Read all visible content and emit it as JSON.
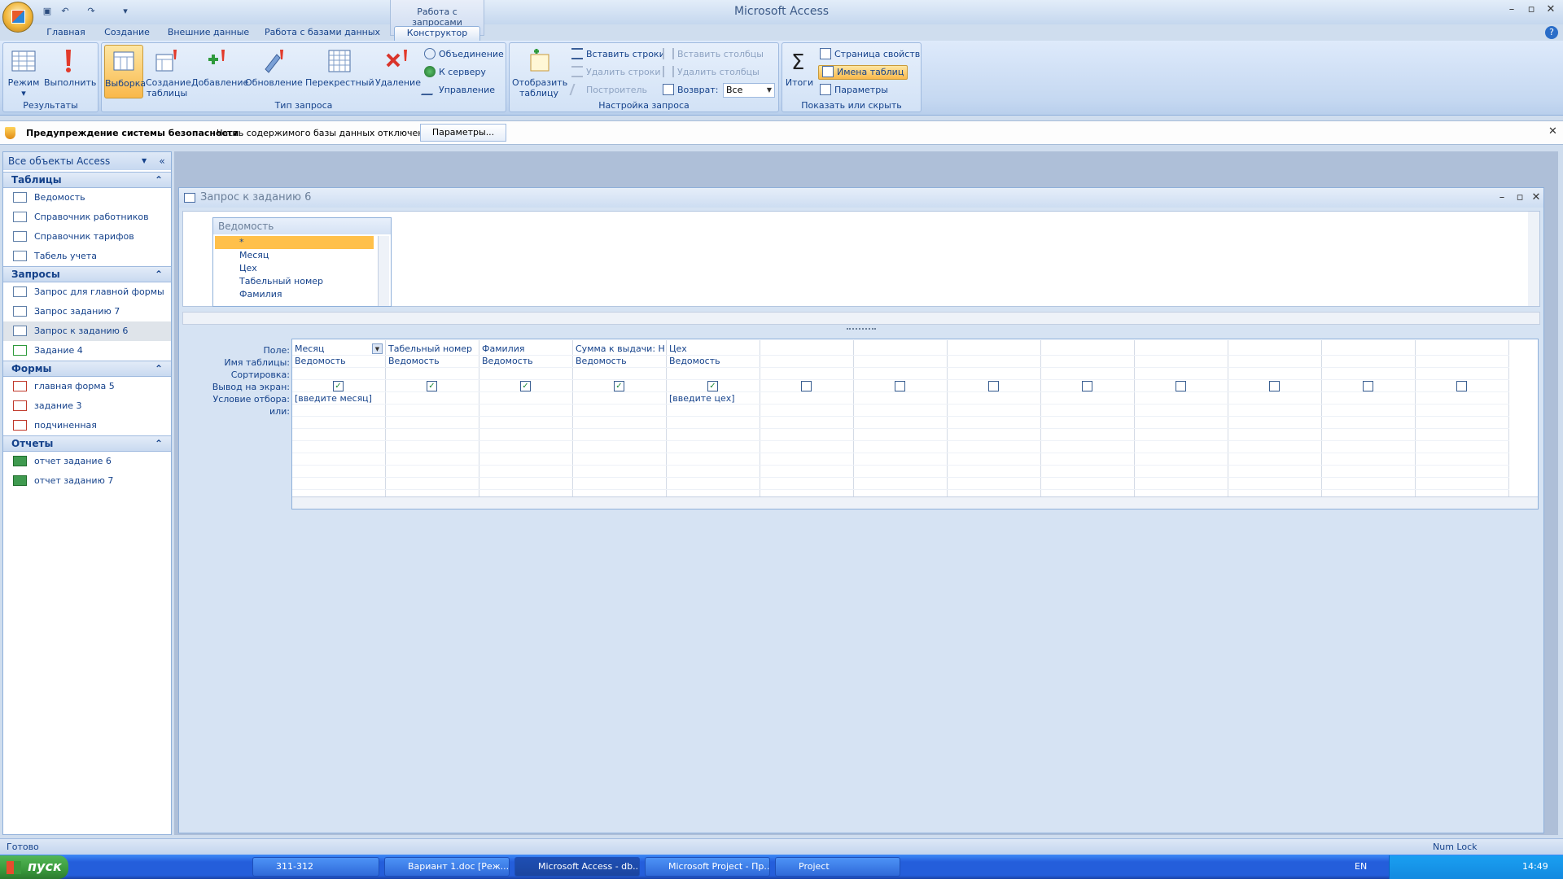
{
  "app": {
    "title": "Microsoft Access",
    "context_group": "Работа с запросами"
  },
  "quick_access": {
    "save": "save-icon",
    "undo": "undo-icon",
    "redo": "redo-icon",
    "more": "▾"
  },
  "tabs": [
    "Главная",
    "Создание",
    "Внешние данные",
    "Работа с базами данных",
    "Конструктор"
  ],
  "ribbon": {
    "results": {
      "caption": "Результаты",
      "view": "Режим",
      "run": "Выполнить"
    },
    "query_type": {
      "caption": "Тип запроса",
      "select": "Выборка",
      "make_table": "Создание таблицы",
      "append": "Добавление",
      "update": "Обновление",
      "crosstab": "Перекрестный",
      "delete": "Удаление",
      "union": "Объединение",
      "pass_through": "К серверу",
      "data_def": "Управление"
    },
    "setup": {
      "caption": "Настройка запроса",
      "show_table": "Отобразить таблицу",
      "insert_rows": "Вставить строки",
      "delete_rows": "Удалить строки",
      "builder": "Построитель",
      "insert_cols": "Вставить столбцы",
      "delete_cols": "Удалить столбцы",
      "return_label": "Возврат:",
      "return_value": "Все"
    },
    "show_hide": {
      "caption": "Показать или скрыть",
      "totals": "Итоги",
      "props": "Страница свойств",
      "table_names": "Имена таблиц",
      "params": "Параметры"
    }
  },
  "security": {
    "title": "Предупреждение системы безопасности",
    "message": "Часть содержимого базы данных отключено",
    "button": "Параметры..."
  },
  "nav": {
    "header": "Все объекты Access",
    "groups": [
      {
        "title": "Таблицы",
        "items": [
          "Ведомость",
          "Справочник работников",
          "Справочник тарифов",
          "Табель учета"
        ]
      },
      {
        "title": "Запросы",
        "items": [
          "Запрос для главной формы ...",
          "Запрос заданию 7",
          "Запрос к заданию 6",
          "Задание 4"
        ]
      },
      {
        "title": "Формы",
        "items": [
          "главная форма 5",
          "задание 3",
          "подчиненная"
        ]
      },
      {
        "title": "Отчеты",
        "items": [
          "отчет задание 6",
          "отчет заданию 7"
        ]
      }
    ]
  },
  "query": {
    "title": "Запрос к заданию 6",
    "table": {
      "name": "Ведомость",
      "fields": [
        "*",
        "Месяц",
        "Цех",
        "Табельный номер",
        "Фамилия"
      ]
    },
    "row_labels": [
      "Поле:",
      "Имя таблицы:",
      "Сортировка:",
      "Вывод на экран:",
      "Условие отбора:",
      "или:"
    ],
    "columns": [
      {
        "field": "Месяц",
        "table": "Ведомость",
        "show": true,
        "criteria": "[введите месяц]"
      },
      {
        "field": "Табельный номер",
        "table": "Ведомость",
        "show": true,
        "criteria": ""
      },
      {
        "field": "Фамилия",
        "table": "Ведомость",
        "show": true,
        "criteria": ""
      },
      {
        "field": "Сумма к выдачи: Нач",
        "table": "Ведомость",
        "show": true,
        "criteria": ""
      },
      {
        "field": "Цех",
        "table": "Ведомость",
        "show": true,
        "criteria": "[введите цех]"
      },
      {
        "field": "",
        "table": "",
        "show": false,
        "criteria": ""
      },
      {
        "field": "",
        "table": "",
        "show": false,
        "criteria": ""
      },
      {
        "field": "",
        "table": "",
        "show": false,
        "criteria": ""
      },
      {
        "field": "",
        "table": "",
        "show": false,
        "criteria": ""
      },
      {
        "field": "",
        "table": "",
        "show": false,
        "criteria": ""
      },
      {
        "field": "",
        "table": "",
        "show": false,
        "criteria": ""
      },
      {
        "field": "",
        "table": "",
        "show": false,
        "criteria": ""
      },
      {
        "field": "",
        "table": "",
        "show": false,
        "criteria": ""
      }
    ]
  },
  "status": {
    "left": "Готово",
    "numlock": "Num Lock"
  },
  "taskbar": {
    "start": "пуск",
    "tasks": [
      "311-312",
      "Вариант 1.doc [Реж...",
      "Microsoft Access - db...",
      "Microsoft Project - Пр...",
      "Project"
    ],
    "lang": "EN",
    "clock": "14:49"
  }
}
